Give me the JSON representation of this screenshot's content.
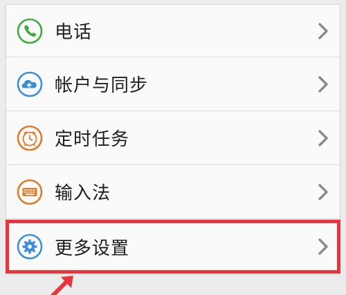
{
  "settings": {
    "items": [
      {
        "label": "电话",
        "icon": "phone-icon",
        "color": "#3bab3b"
      },
      {
        "label": "帐户与同步",
        "icon": "cloud-sync-icon",
        "color": "#3a8fd6"
      },
      {
        "label": "定时任务",
        "icon": "clock-icon",
        "color": "#e07a28"
      },
      {
        "label": "输入法",
        "icon": "keyboard-icon",
        "color": "#e07a28"
      },
      {
        "label": "更多设置",
        "icon": "gear-icon",
        "color": "#3a8fd6"
      }
    ]
  },
  "annotation": {
    "highlight_color": "#e8343a",
    "arrow": "arrow-pointer-icon"
  }
}
